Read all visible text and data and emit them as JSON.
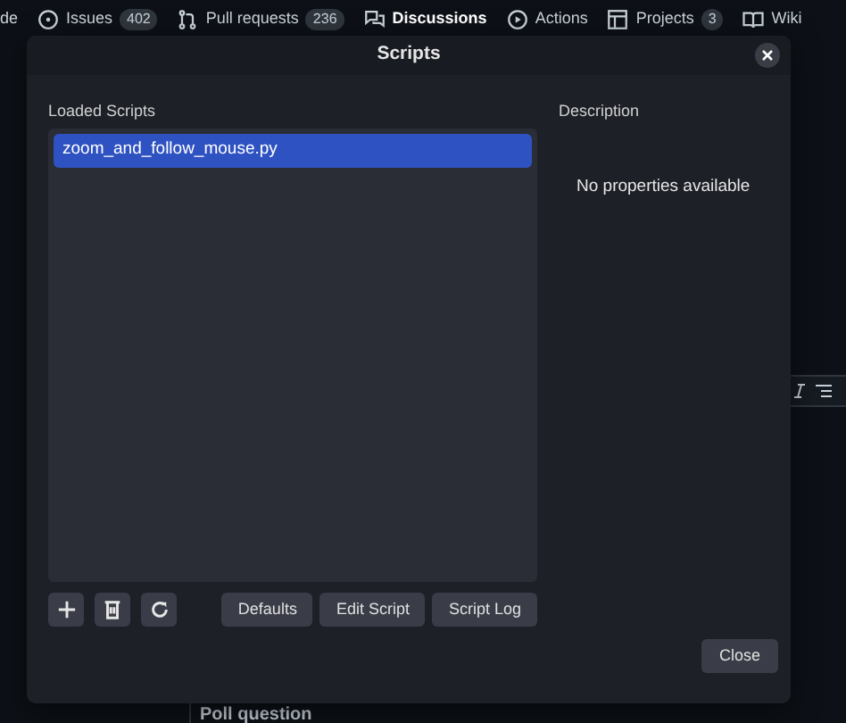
{
  "nav": {
    "items": [
      {
        "label": "de",
        "kind": "plain",
        "selected": false
      },
      {
        "label": "Issues",
        "kind": "issues",
        "count": "402",
        "selected": false
      },
      {
        "label": "Pull requests",
        "kind": "pulls",
        "count": "236",
        "selected": false
      },
      {
        "label": "Discussions",
        "kind": "discussions",
        "selected": true
      },
      {
        "label": "Actions",
        "kind": "actions",
        "selected": false
      },
      {
        "label": "Projects",
        "kind": "projects",
        "count": "3",
        "selected": false
      },
      {
        "label": "Wiki",
        "kind": "wiki",
        "selected": false
      }
    ]
  },
  "background": {
    "poll_label": "Poll question"
  },
  "dialog": {
    "title": "Scripts",
    "loaded_label": "Loaded Scripts",
    "scripts": [
      {
        "name": "zoom_and_follow_mouse.py",
        "selected": true
      }
    ],
    "description_label": "Description",
    "empty_text": "No properties available",
    "icon_buttons": [
      {
        "kind": "add"
      },
      {
        "kind": "remove"
      },
      {
        "kind": "reload"
      }
    ],
    "buttons": [
      "Defaults",
      "Edit Script",
      "Script Log"
    ],
    "close_button": "Close"
  }
}
